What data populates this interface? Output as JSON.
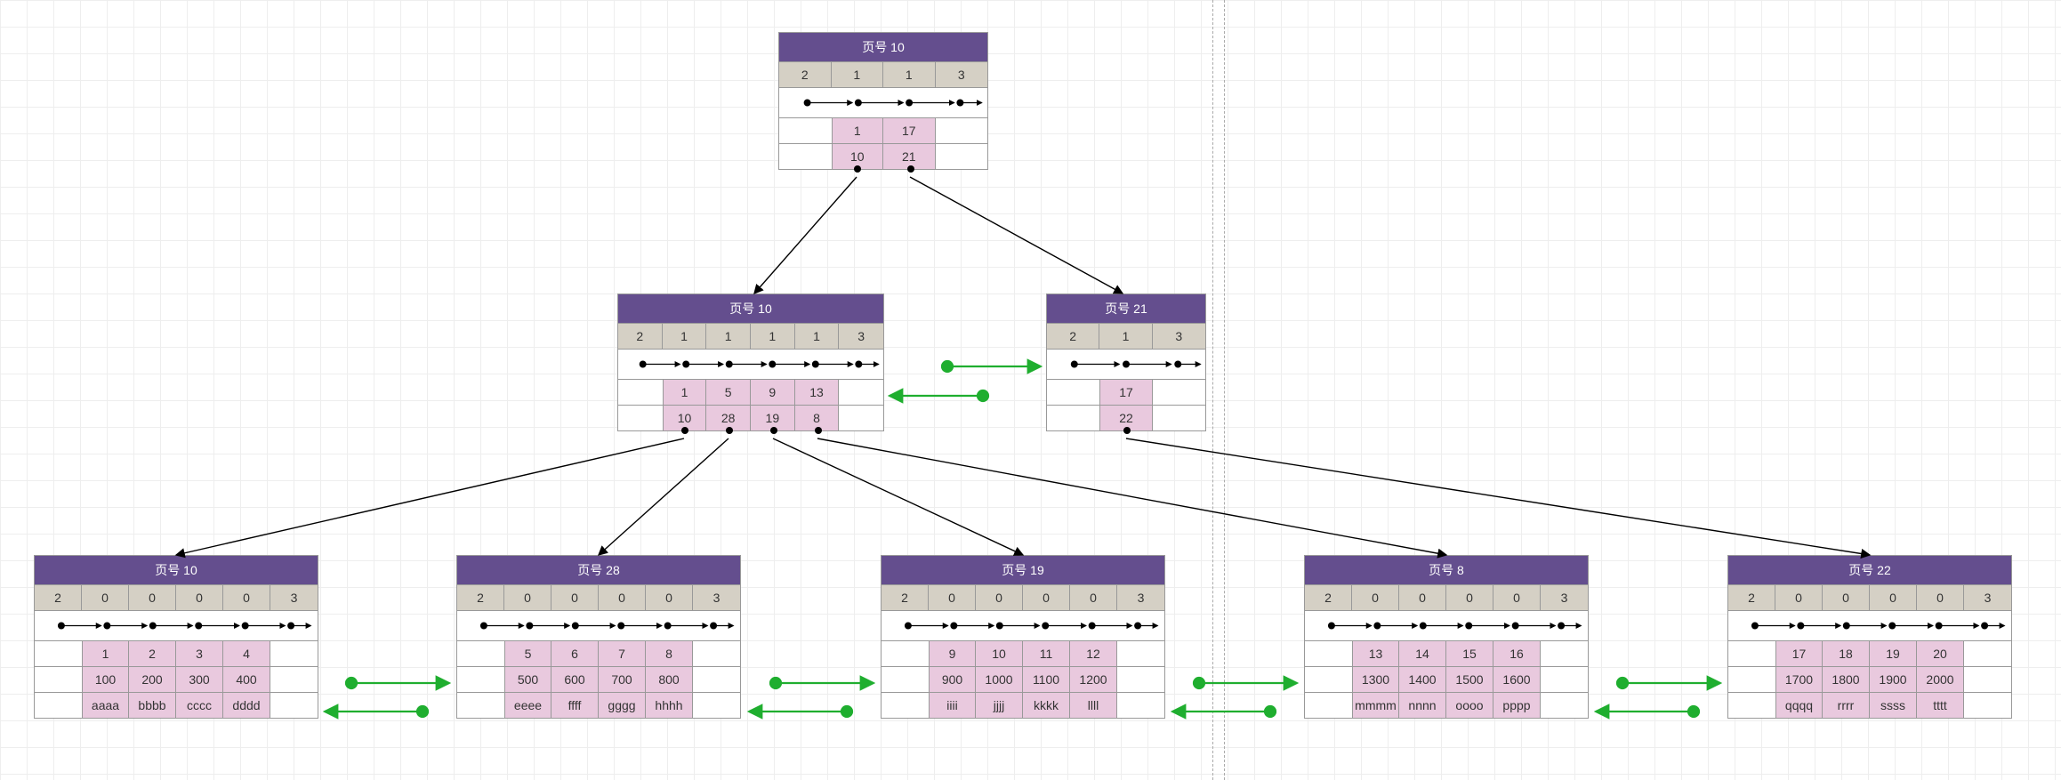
{
  "title_prefix": "页号 ",
  "nodes": {
    "root": {
      "page": 10,
      "header": [
        2,
        1,
        1,
        3
      ],
      "keys": [
        1,
        17
      ],
      "ptrs": [
        10,
        21
      ]
    },
    "mid_left": {
      "page": 10,
      "header": [
        2,
        1,
        1,
        1,
        1,
        3
      ],
      "keys": [
        1,
        5,
        9,
        13
      ],
      "ptrs": [
        10,
        28,
        19,
        8
      ]
    },
    "mid_right": {
      "page": 21,
      "header": [
        2,
        1,
        3
      ],
      "keys": [
        17
      ],
      "ptrs": [
        22
      ]
    },
    "leaf1": {
      "page": 10,
      "header": [
        2,
        0,
        0,
        0,
        0,
        3
      ],
      "rows": [
        [
          1,
          2,
          3,
          4
        ],
        [
          100,
          200,
          300,
          400
        ],
        [
          "aaaa",
          "bbbb",
          "cccc",
          "dddd"
        ]
      ]
    },
    "leaf2": {
      "page": 28,
      "header": [
        2,
        0,
        0,
        0,
        0,
        3
      ],
      "rows": [
        [
          5,
          6,
          7,
          8
        ],
        [
          500,
          600,
          700,
          800
        ],
        [
          "eeee",
          "ffff",
          "gggg",
          "hhhh"
        ]
      ]
    },
    "leaf3": {
      "page": 19,
      "header": [
        2,
        0,
        0,
        0,
        0,
        3
      ],
      "rows": [
        [
          9,
          10,
          11,
          12
        ],
        [
          900,
          1000,
          1100,
          1200
        ],
        [
          "iiii",
          "jjjj",
          "kkkk",
          "llll"
        ]
      ]
    },
    "leaf4": {
      "page": 8,
      "header": [
        2,
        0,
        0,
        0,
        0,
        3
      ],
      "rows": [
        [
          13,
          14,
          15,
          16
        ],
        [
          1300,
          1400,
          1500,
          1600
        ],
        [
          "mmmm",
          "nnnn",
          "oooo",
          "pppp"
        ]
      ]
    },
    "leaf5": {
      "page": 22,
      "header": [
        2,
        0,
        0,
        0,
        0,
        3
      ],
      "rows": [
        [
          17,
          18,
          19,
          20
        ],
        [
          1700,
          1800,
          1900,
          2000
        ],
        [
          "qqqq",
          "rrrr",
          "ssss",
          "tttt"
        ]
      ]
    }
  }
}
